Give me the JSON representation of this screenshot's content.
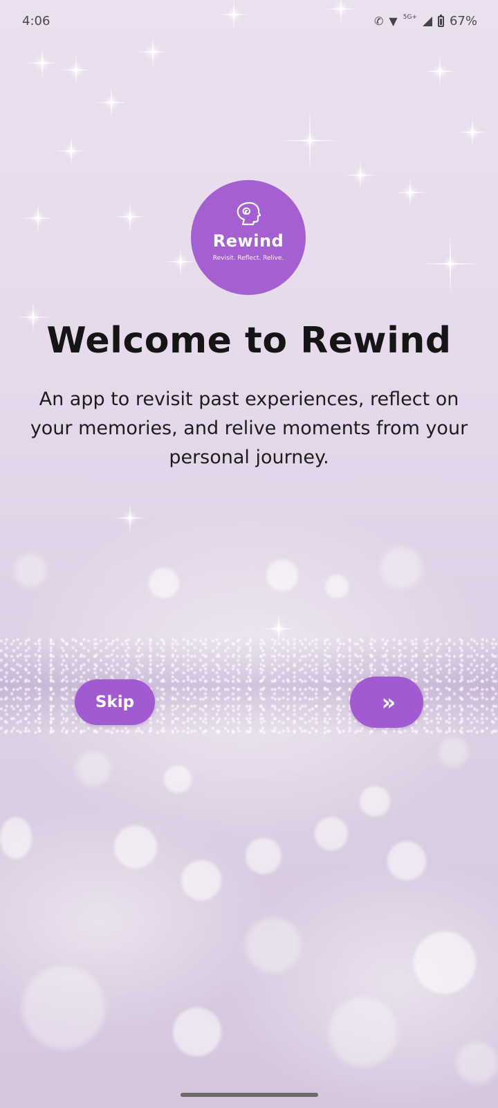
{
  "status_bar": {
    "time": "4:06",
    "network": "5G+",
    "battery": "67%",
    "icons": [
      "call-icon",
      "wifi-icon",
      "signal-icon",
      "battery-icon"
    ]
  },
  "logo": {
    "name": "Rewind",
    "tagline": "Revisit. Reflect. Relive.",
    "icon": "head-spiral-icon"
  },
  "welcome": {
    "title": "Welcome to Rewind",
    "description": "An app to revisit past experiences, reflect on your memories, and relive moments from your personal journey."
  },
  "actions": {
    "skip_label": "Skip",
    "next_icon": "»"
  },
  "colors": {
    "accent": "#A25AD0",
    "logo_bg": "#A45FD0",
    "text": "#151515"
  }
}
